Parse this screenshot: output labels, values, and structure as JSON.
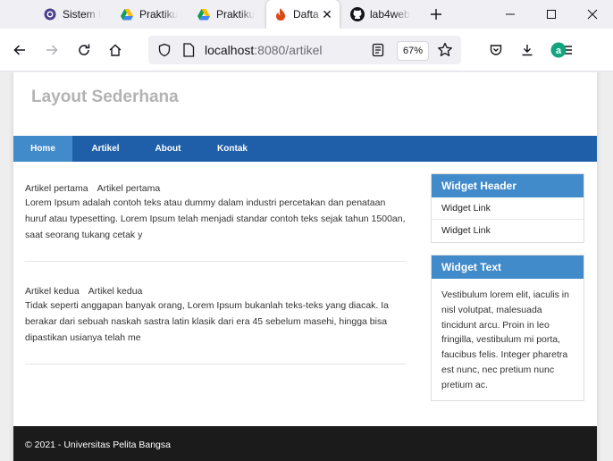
{
  "browser": {
    "tabs": [
      {
        "title": "Sistem I",
        "icon": "university-seal-icon",
        "active": false
      },
      {
        "title": "Praktiku",
        "icon": "google-drive-icon",
        "active": false
      },
      {
        "title": "Praktiku",
        "icon": "google-drive-icon",
        "active": false
      },
      {
        "title": "Dafta",
        "icon": "codeigniter-flame-icon",
        "active": true
      },
      {
        "title": "lab4web",
        "icon": "github-icon",
        "active": false
      }
    ],
    "url_host": "localhost",
    "url_path": ":8080/artikel",
    "zoom": "67%",
    "accent": "#1f5faa"
  },
  "site": {
    "title": "Layout Sederhana",
    "nav": [
      "Home",
      "Artikel",
      "About",
      "Kontak"
    ],
    "articles": [
      {
        "title_a": "Artikel pertama",
        "title_b": "Artikel pertama",
        "body": "Lorem Ipsum adalah contoh teks atau dummy dalam industri percetakan dan penataan huruf atau typesetting. Lorem Ipsum telah menjadi standar contoh teks sejak tahun 1500an, saat seorang tukang cetak y"
      },
      {
        "title_a": "Artikel kedua",
        "title_b": "Artikel kedua",
        "body": "Tidak seperti anggapan banyak orang, Lorem Ipsum bukanlah teks-teks yang diacak. Ia berakar dari sebuah naskah sastra latin klasik dari era 45 sebelum masehi, hingga bisa dipastikan usianya telah me"
      }
    ],
    "widget_header": {
      "title": "Widget Header",
      "links": [
        "Widget Link",
        "Widget Link"
      ]
    },
    "widget_text": {
      "title": "Widget Text",
      "body": "Vestibulum lorem elit, iaculis in nisl volutpat, malesuada tincidunt arcu. Proin in leo fringilla, vestibulum mi porta, faucibus felis. Integer pharetra est nunc, nec pretium nunc pretium ac."
    },
    "footer": "© 2021 - Universitas Pelita Bangsa"
  }
}
